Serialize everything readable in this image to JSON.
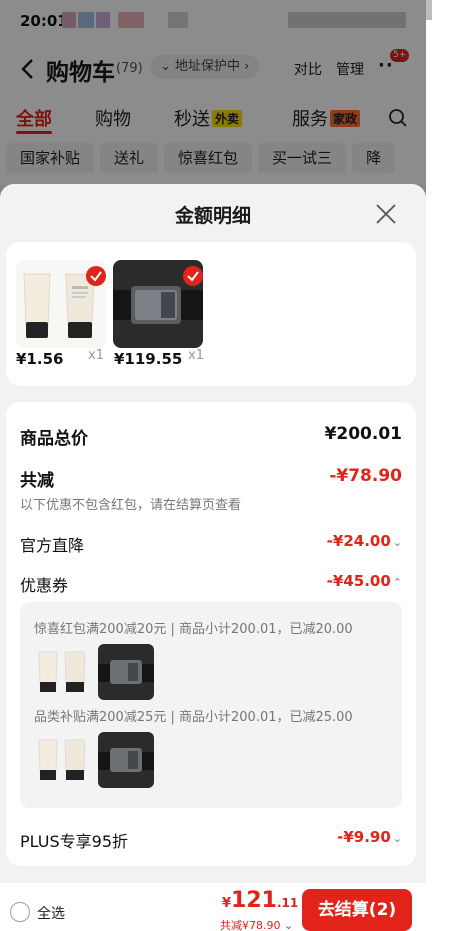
{
  "status_bar": {
    "time": "20:01"
  },
  "header": {
    "title": "购物车",
    "count": "(79)",
    "address_protect": "地址保护中",
    "compare": "对比",
    "manage": "管理",
    "badge": "5+"
  },
  "tabs": [
    {
      "label": "全部"
    },
    {
      "label": "购物"
    },
    {
      "label": "秒送",
      "tag": "外卖"
    },
    {
      "label": "服务",
      "tag": "家政"
    }
  ],
  "chips": [
    "国家补贴",
    "送礼",
    "惊喜红包",
    "买一试三",
    "降"
  ],
  "sheet": {
    "title": "金额明细",
    "products": [
      {
        "price": "¥1.56",
        "qty": "x1",
        "thumb_icon": "lotion-tubes-icon"
      },
      {
        "price": "¥119.55",
        "qty": "x1",
        "thumb_icon": "belt-buckle-icon"
      }
    ],
    "summary": {
      "total_label": "商品总价",
      "total_value": "¥200.01",
      "discount_label": "共减",
      "discount_value": "-¥78.90",
      "discount_note": "以下优惠不包含红包，请在结算页查看",
      "official_label": "官方直降",
      "official_value": "-¥24.00",
      "coupon_label": "优惠券",
      "coupon_value": "-¥45.00",
      "coupons": [
        {
          "text": "惊喜红包满200减20元 | 商品小计200.01，已减20.00"
        },
        {
          "text": "品类补贴满200减25元 | 商品小计200.01，已减25.00"
        }
      ],
      "plus_label": "PLUS专享95折",
      "plus_value": "-¥9.90"
    }
  },
  "bottom": {
    "select_all": "全选",
    "total_symbol": "¥",
    "total_int": "121",
    "total_dec": ".11",
    "saved": "共减¥78.90",
    "checkout": "去结算(2)"
  },
  "colors": {
    "accent": "#e2231a",
    "tag_yellow": "#ffde00"
  }
}
